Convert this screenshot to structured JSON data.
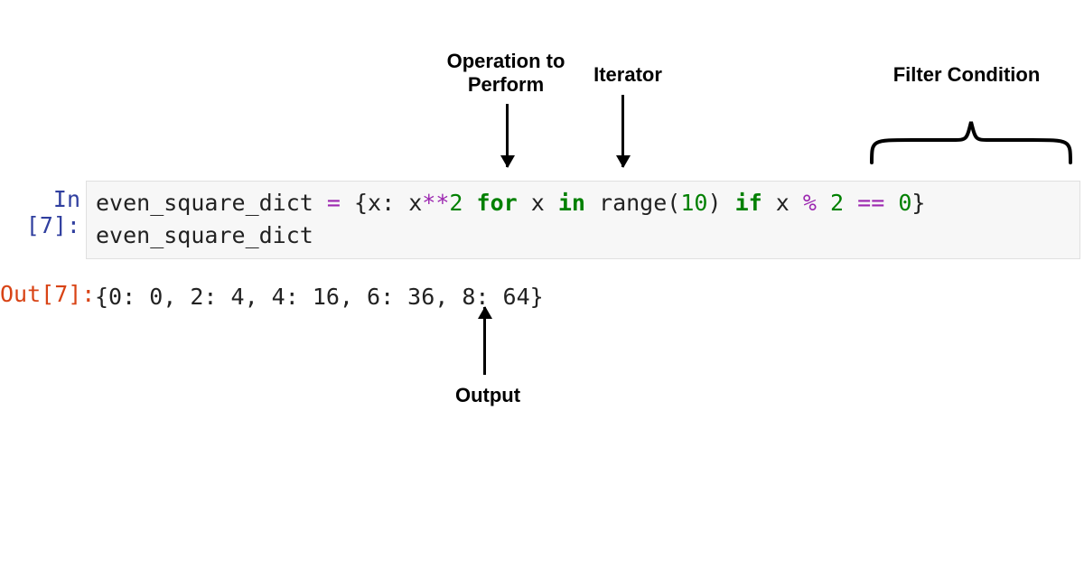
{
  "annotations": {
    "operation": "Operation to\nPerform",
    "iterator": "Iterator",
    "filter": "Filter Condition",
    "output": "Output"
  },
  "prompts": {
    "in": "In [7]:",
    "out": "Out[7]:"
  },
  "code": {
    "var": "even_square_dict",
    "assign": " = ",
    "open": "{",
    "key": "x",
    "colon": ": ",
    "val1": "x",
    "pow": "**",
    "val2": "2",
    "sp1": " ",
    "for": "for",
    "sp2": " ",
    "loopvar": "x",
    "sp3": " ",
    "in": "in",
    "sp4": " ",
    "range": "range",
    "lpar": "(",
    "rangearg": "10",
    "rpar": ")",
    "sp5": " ",
    "if": "if",
    "sp6": " ",
    "cond1": "x",
    "sp7": " ",
    "mod": "%",
    "sp8": " ",
    "cond2": "2",
    "sp9": " ",
    "eq": "==",
    "sp10": " ",
    "cond3": "0",
    "close": "}",
    "line2": "even_square_dict"
  },
  "output": "{0: 0, 2: 4, 4: 16, 6: 36, 8: 64}"
}
